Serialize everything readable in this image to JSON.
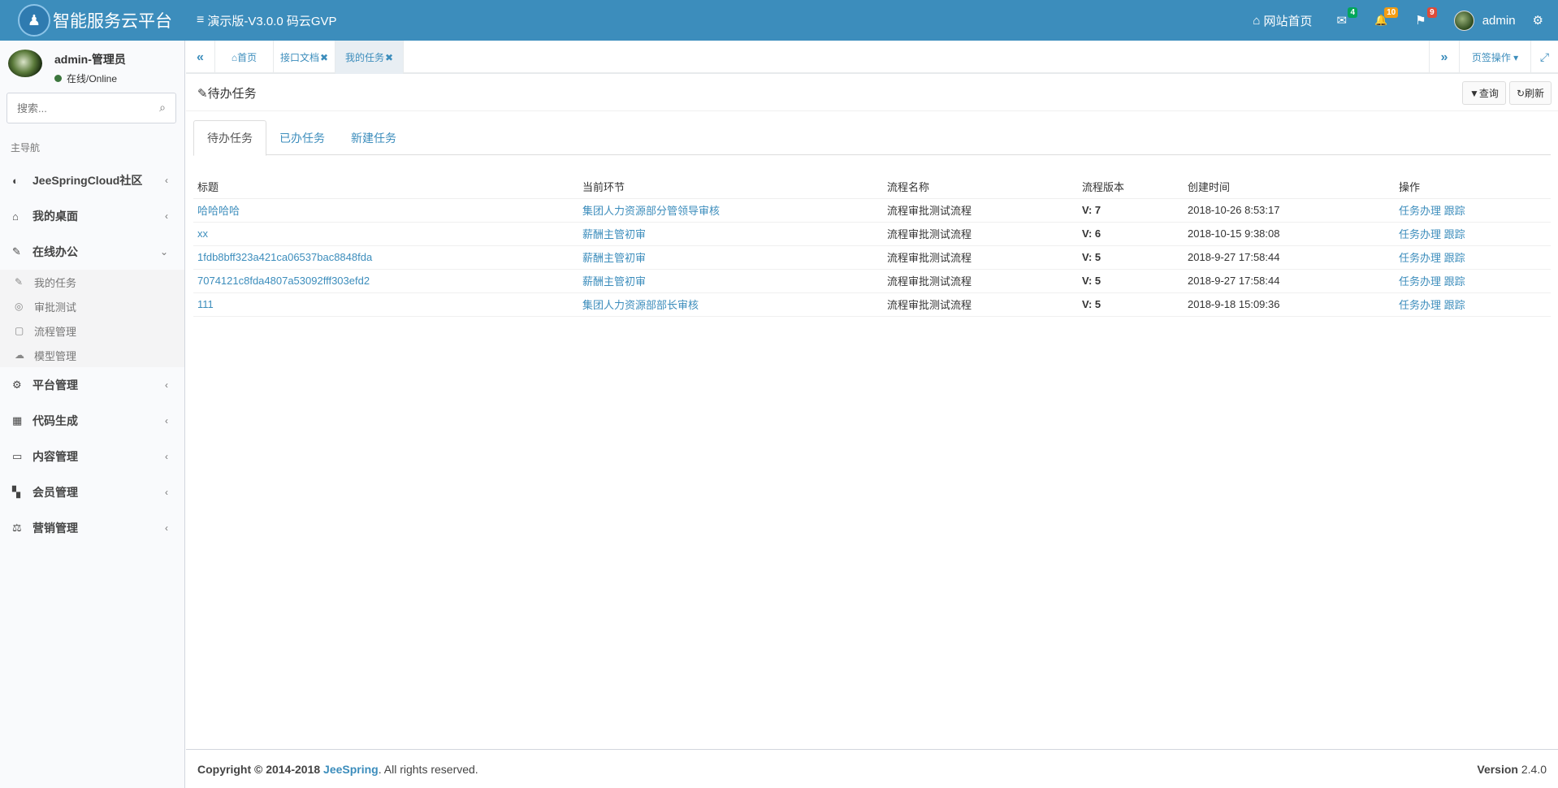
{
  "header": {
    "logo_glyph": "♟",
    "app_title": "智能服务云平台",
    "toggle_icon": "≡",
    "version_label": "演示版-V3.0.0 码云GVP",
    "site_home_icon": "⌂",
    "site_home": "网站首页",
    "mail_icon": "✉",
    "mail_count": "4",
    "bell_icon": "🔔",
    "bell_count": "10",
    "flag_icon": "⚑",
    "flag_count": "9",
    "username": "admin",
    "settings_icon": "⚙"
  },
  "sidebar": {
    "user_name": "admin-管理员",
    "status": "在线/Online",
    "search_placeholder": "搜索...",
    "search_icon": "⌕",
    "nav_header": "主导航",
    "items": [
      {
        "icon": "◐",
        "label": "JeeSpringCloud社区",
        "chev": "‹"
      },
      {
        "icon": "⌂",
        "label": "我的桌面",
        "chev": "‹"
      },
      {
        "icon": "✎",
        "label": "在线办公",
        "chev": "⌄"
      },
      {
        "icon": "⚙",
        "label": "平台管理",
        "chev": "‹"
      },
      {
        "icon": "▦",
        "label": "代码生成",
        "chev": "‹"
      },
      {
        "icon": "▭",
        "label": "内容管理",
        "chev": "‹"
      },
      {
        "icon": "▚",
        "label": "会员管理",
        "chev": "‹"
      },
      {
        "icon": "⚖",
        "label": "营销管理",
        "chev": "‹"
      }
    ],
    "sub_items": [
      {
        "icon": "✎",
        "label": "我的任务"
      },
      {
        "icon": "◎",
        "label": "审批测试"
      },
      {
        "icon": "▢",
        "label": "流程管理"
      },
      {
        "icon": "☁",
        "label": "模型管理"
      }
    ]
  },
  "tabbar": {
    "prev_icon": "«",
    "home_tab": "⌂首页",
    "tab_api": "接口文档",
    "tab_tasks": "我的任务",
    "close_icon": "✖",
    "next_icon": "»",
    "page_ops": "页签操作 ▾",
    "fullscreen_icon": "⤢"
  },
  "content": {
    "title": "待办任务",
    "title_icon": "✎",
    "btn_query": "▼查询",
    "btn_refresh": "↻刷新",
    "tabs": [
      "待办任务",
      "已办任务",
      "新建任务"
    ],
    "columns": [
      "标题",
      "当前环节",
      "流程名称",
      "流程版本",
      "创建时间",
      "操作"
    ],
    "rows": [
      {
        "title": "哈哈哈哈",
        "step": "集团人力资源部分管领导审核",
        "process": "流程审批测试流程",
        "version": "V: 7",
        "created": "2018-10-26 8:53:17",
        "op1": "任务办理",
        "op2": "跟踪"
      },
      {
        "title": "xx",
        "step": "薪酬主管初审",
        "process": "流程审批测试流程",
        "version": "V: 6",
        "created": "2018-10-15 9:38:08",
        "op1": "任务办理",
        "op2": "跟踪"
      },
      {
        "title": "1fdb8bff323a421ca06537bac8848fda",
        "step": "薪酬主管初审",
        "process": "流程审批测试流程",
        "version": "V: 5",
        "created": "2018-9-27 17:58:44",
        "op1": "任务办理",
        "op2": "跟踪"
      },
      {
        "title": "7074121c8fda4807a53092fff303efd2",
        "step": "薪酬主管初审",
        "process": "流程审批测试流程",
        "version": "V: 5",
        "created": "2018-9-27 17:58:44",
        "op1": "任务办理",
        "op2": "跟踪"
      },
      {
        "title": "111",
        "step": "集团人力资源部部长审核",
        "process": "流程审批测试流程",
        "version": "V: 5",
        "created": "2018-9-18 15:09:36",
        "op1": "任务办理",
        "op2": "跟踪"
      }
    ]
  },
  "footer": {
    "copyright": "Copyright © 2014-2018 ",
    "brand": "JeeSpring",
    "rights": ". All rights reserved.",
    "version_label": "Version",
    "version": " 2.4.0"
  }
}
